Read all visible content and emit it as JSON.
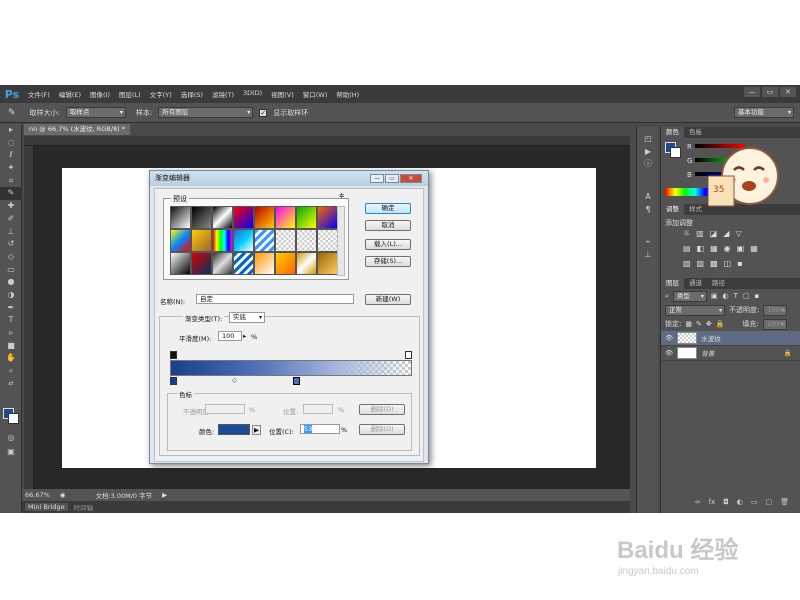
{
  "app": {
    "logo": "Ps"
  },
  "menu": [
    "文件(F)",
    "编辑(E)",
    "图像(I)",
    "图层(L)",
    "文字(Y)",
    "选择(S)",
    "滤镜(T)",
    "3D(D)",
    "视图(V)",
    "窗口(W)",
    "帮助(H)"
  ],
  "window_controls": [
    "—",
    "▭",
    "✕"
  ],
  "options": {
    "sample_size_label": "取样大小:",
    "sample_size_value": "取样点",
    "sample_label": "样本:",
    "sample_value": "所有图层",
    "show_ring_label": "显示取样环",
    "workspace": "基本功能"
  },
  "doc_tab": "nn @ 66.7% (水波纹, RGB/8) *",
  "status": {
    "zoom": "66.67%",
    "doc": "文档:3.00M/0 字节"
  },
  "bottom_tabs": [
    "Mini Bridge",
    "时间轴"
  ],
  "panels": {
    "color_tabs": [
      "颜色",
      "色板"
    ],
    "rgb_labels": [
      "R",
      "G",
      "B"
    ],
    "adjust_tabs": [
      "调整",
      "样式"
    ],
    "adjust_title": "添加调整",
    "layer_tabs": [
      "图层",
      "通道",
      "路径"
    ],
    "filter_kind": "类型",
    "blend_mode": "正常",
    "opacity_label": "不透明度:",
    "opacity_value": "100%",
    "lock_label": "锁定:",
    "fill_label": "填充:",
    "fill_value": "100%",
    "layers": [
      {
        "name": "水波纹"
      },
      {
        "name": "背景"
      }
    ]
  },
  "dialog": {
    "title": "渐变编辑器",
    "presets_label": "预设",
    "ok": "确定",
    "cancel": "取消",
    "load": "载入(L)...",
    "save": "存储(S)...",
    "name_label": "名称(N):",
    "name_value": "自定",
    "new_button": "新建(W)",
    "type_label": "渐变类型(T):",
    "type_value": "实底",
    "smooth_label": "平滑度(M):",
    "smooth_value": "100",
    "percent": "%",
    "stops_label": "色标",
    "opacity_label": "不透明度:",
    "location_label": "位置:",
    "delete_label": "删除(D)",
    "color_label": "颜色:",
    "color_location_label": "位置(C):",
    "color_location_value": "53",
    "color_swatch": "#1b4b96"
  },
  "watermark": {
    "brand": "Baidu 经验",
    "url": "jingyan.baidu.com"
  }
}
